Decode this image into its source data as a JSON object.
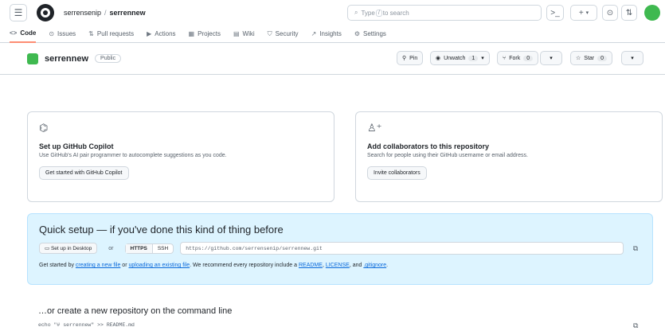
{
  "header": {
    "owner": "serrensenip",
    "separator": "/",
    "repo": "serrennew",
    "search_placeholder": "Type / to search",
    "search_prefix": "Type",
    "search_key": "/",
    "search_suffix": "to search"
  },
  "nav": [
    {
      "label": "Code",
      "icon": "<>"
    },
    {
      "label": "Issues",
      "icon": "⊙"
    },
    {
      "label": "Pull requests",
      "icon": "⇅"
    },
    {
      "label": "Actions",
      "icon": "▶"
    },
    {
      "label": "Projects",
      "icon": "▦"
    },
    {
      "label": "Wiki",
      "icon": "▤"
    },
    {
      "label": "Security",
      "icon": "⛉"
    },
    {
      "label": "Insights",
      "icon": "↗"
    },
    {
      "label": "Settings",
      "icon": "⚙"
    }
  ],
  "repo_header": {
    "name": "serrennew",
    "visibility": "Public",
    "pin": "Pin",
    "unwatch": "Unwatch",
    "unwatch_count": "1",
    "fork": "Fork",
    "fork_count": "0",
    "star": "Star",
    "star_count": "0"
  },
  "cards": {
    "copilot": {
      "title": "Set up GitHub Copilot",
      "desc": "Use GitHub's AI pair programmer to autocomplete suggestions as you code.",
      "button": "Get started with GitHub Copilot"
    },
    "collab": {
      "title": "Add collaborators to this repository",
      "desc": "Search for people using their GitHub username or email address.",
      "button": "Invite collaborators"
    }
  },
  "quick_setup": {
    "title": "Quick setup — if you've done this kind of thing before",
    "desktop_btn": "Set up in Desktop",
    "or": "or",
    "https": "HTTPS",
    "ssh": "SSH",
    "url": "https://github.com/serrensenip/serrennew.git",
    "help_prefix": "Get started by",
    "link_new_file": "creating a new file",
    "help_or": "or",
    "link_upload": "uploading an existing file",
    "help_mid": ". We recommend every repository include a",
    "link_readme": "README",
    "comma": ",",
    "link_license": "LICENSE",
    "help_and": ", and",
    "link_gitignore": ".gitignore",
    "period": "."
  },
  "cli": {
    "title": "…or create a new repository on the command line",
    "line1": "echo \"# serrennew\" >> README.md"
  },
  "colors": {
    "accent": "#fd8c73",
    "link": "#0969da",
    "quick_bg": "#ddf4ff",
    "avatar": "#3fb950"
  }
}
